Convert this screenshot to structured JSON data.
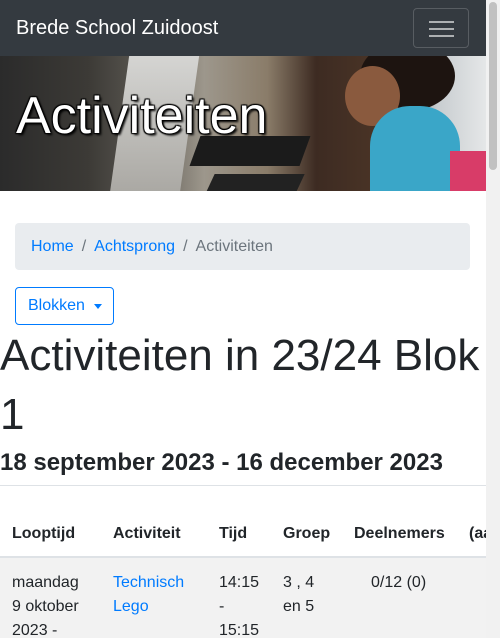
{
  "navbar": {
    "brand": "Brede School Zuidoost",
    "toggler_icon": "hamburger-icon"
  },
  "hero": {
    "title": "Activiteiten"
  },
  "breadcrumb": {
    "items": [
      "Home",
      "Achtsprong",
      "Activiteiten"
    ],
    "separator": "/"
  },
  "dropdown": {
    "label": "Blokken"
  },
  "page": {
    "title": "Activiteiten in 23/24 Blok 1",
    "dates": "18 september 2023 - 16 december 2023"
  },
  "table": {
    "headers": [
      "Looptijd",
      "Activiteit",
      "Tijd",
      "Groep",
      "Deelnemers",
      "(aa"
    ],
    "rows": [
      {
        "looptijd": [
          "maandag",
          "9 oktober",
          "2023 -"
        ],
        "activiteit": [
          "Technisch",
          "Lego"
        ],
        "tijd": [
          "14:15",
          "-",
          "15:15"
        ],
        "groep": [
          "3 , 4",
          "en 5"
        ],
        "deelnemers": "0/12 (0)"
      }
    ]
  },
  "colors": {
    "primary": "#007bff",
    "navbar_bg": "#343a40",
    "breadcrumb_bg": "#e9ecef",
    "row_stripe": "#f2f2f2"
  }
}
